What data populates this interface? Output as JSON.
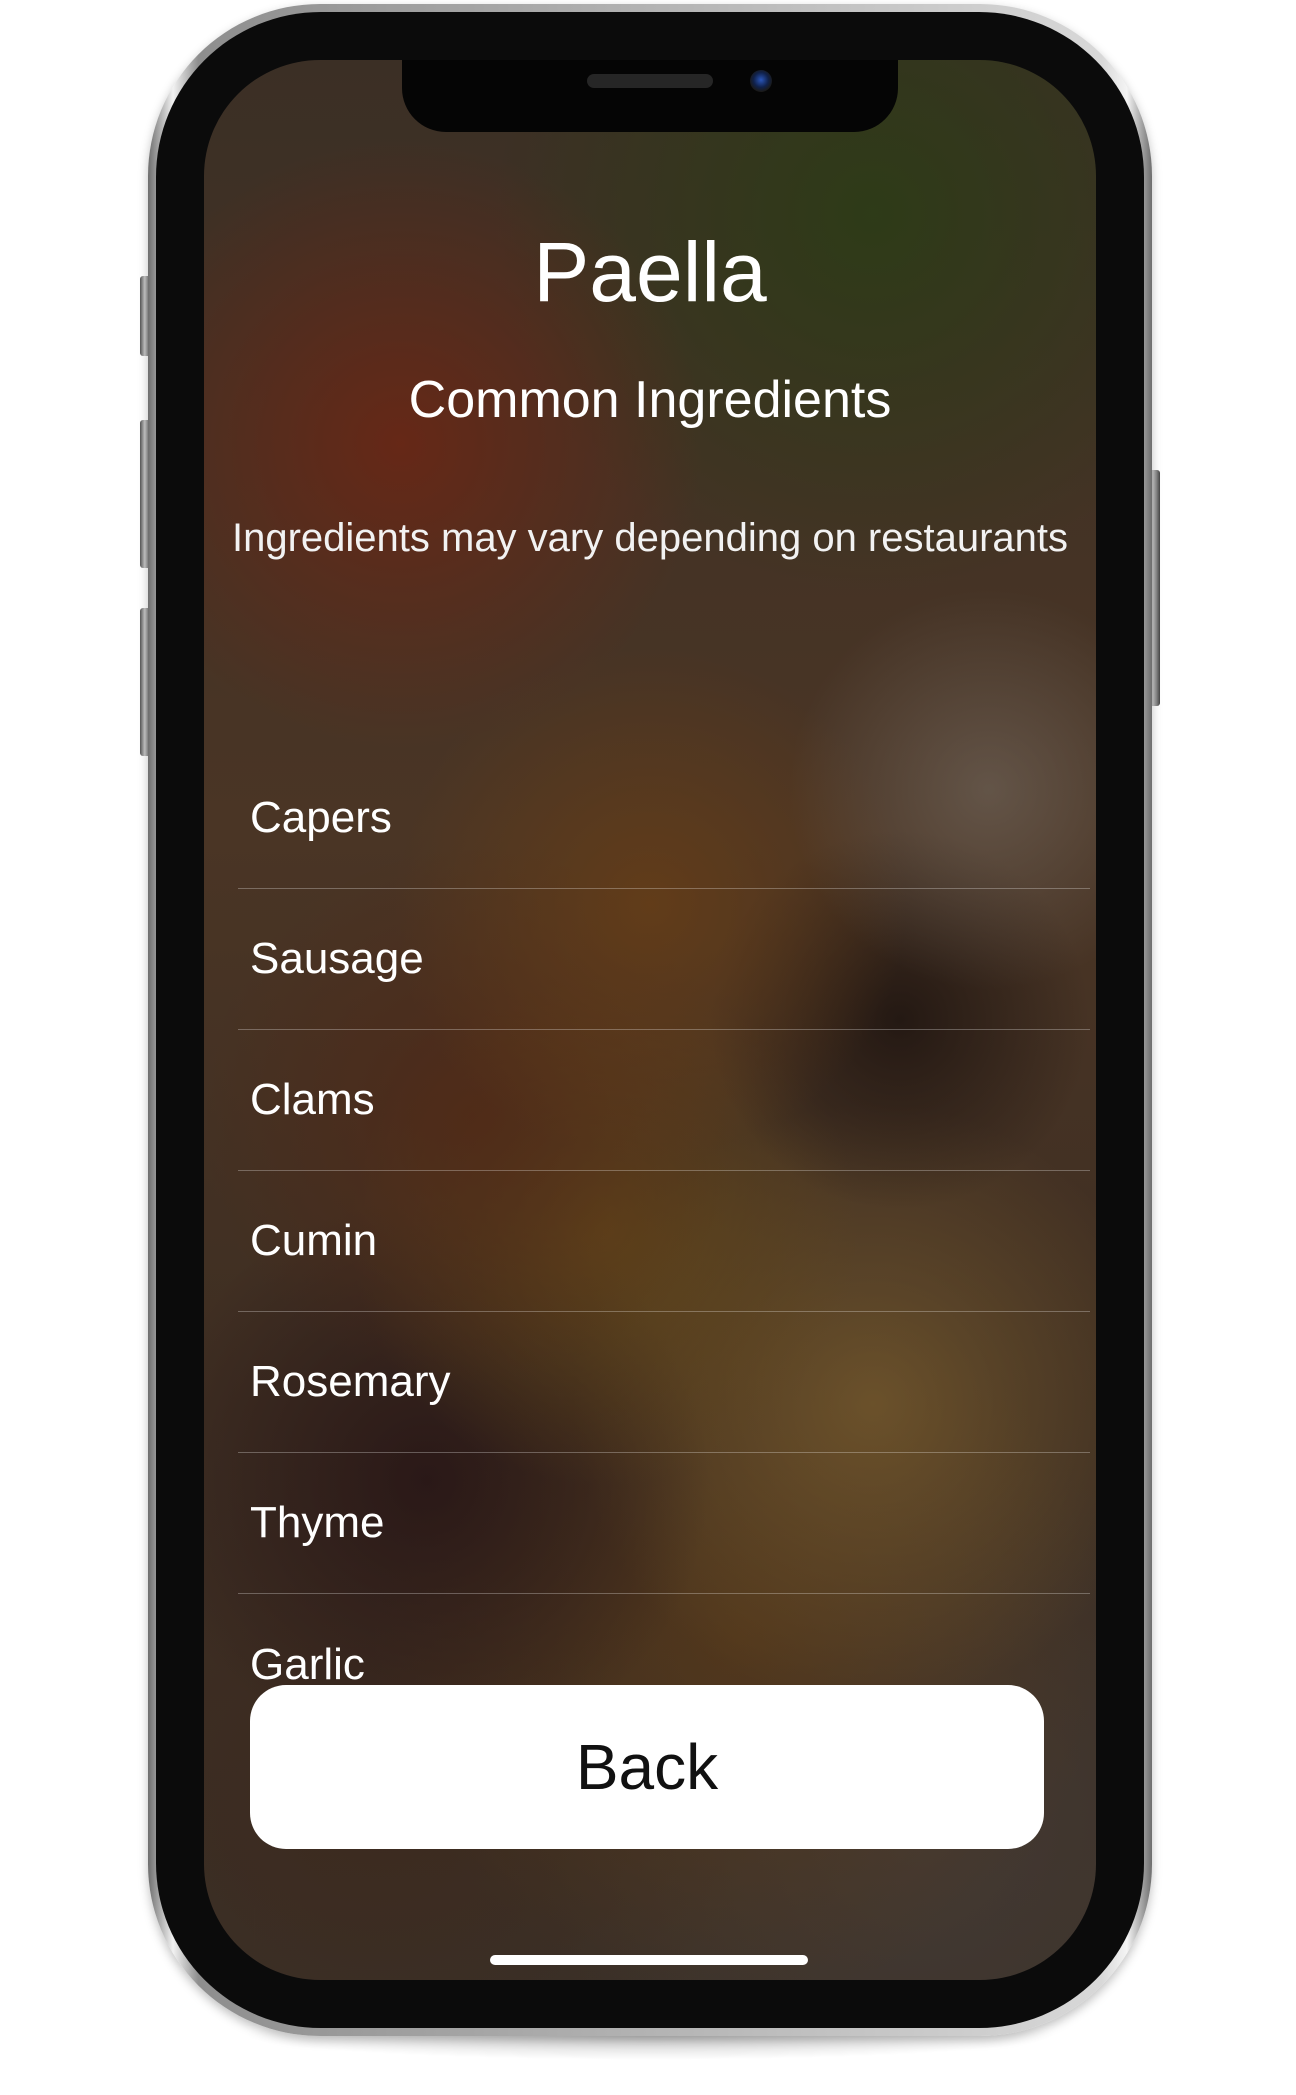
{
  "screen": {
    "title": "Paella",
    "subtitle": "Common Ingredients",
    "note": "Ingredients may vary depending on restaurants",
    "ingredients": [
      "Capers",
      "Sausage",
      "Clams",
      "Cumin",
      "Rosemary",
      "Thyme",
      "Garlic"
    ],
    "back_label": "Back"
  },
  "device": {
    "frame_color": "#1a1a1a",
    "button_color": "#ffffff"
  }
}
